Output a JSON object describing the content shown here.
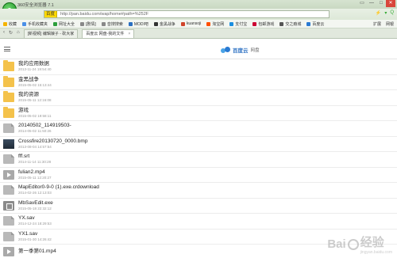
{
  "browser": {
    "title": "360安全浏览器 7.1",
    "controls": [
      "▭",
      "—",
      "□",
      "✕"
    ],
    "engine_label": "百度",
    "url": "http://pan.baidu.com/wap/home#path=%252F",
    "addr_right": [
      "⚡",
      "▾",
      "Q"
    ]
  },
  "bookmarks": {
    "items": [
      {
        "label": "收藏",
        "color": "#f5b400"
      },
      {
        "label": "手机收藏夹",
        "color": "#4a8fe7"
      },
      {
        "label": "网址大全",
        "color": "#2c9e3b"
      },
      {
        "label": "[剧情] ",
        "color": "#888"
      },
      {
        "label": "音搜搜索",
        "color": "#888"
      },
      {
        "label": "MODI吧",
        "color": "#2a6fc2"
      },
      {
        "label": "金黑战争",
        "color": "#333"
      },
      {
        "label": "kuansoji",
        "color": "#d0442b"
      },
      {
        "label": "淘宝网",
        "color": "#ff5000"
      },
      {
        "label": "支付宝",
        "color": "#1a8ee0"
      },
      {
        "label": "包邮游戏",
        "color": "#c03"
      },
      {
        "label": "交之瘾城",
        "color": "#555"
      },
      {
        "label": "百度云",
        "color": "#2a7ad3"
      }
    ],
    "ext": [
      "扩展",
      "网银"
    ]
  },
  "tabs": {
    "icons": [
      "‹",
      "↻",
      "⌂"
    ],
    "items": [
      {
        "label": "[新视频] 编辑娘子 - 砍大家",
        "active": false
      },
      {
        "label": "百度云 网盘-我的文件",
        "active": true
      }
    ]
  },
  "page": {
    "brand_name": "百度云",
    "brand_sub": "网盘",
    "files": [
      {
        "name": "我的应用数据",
        "date": "2013-11-24 19:54:40",
        "type": "folder"
      },
      {
        "name": "金黑战争",
        "date": "2015-05-02 15:13:44",
        "type": "folder"
      },
      {
        "name": "我的资源",
        "date": "2015-05-11 12:16:08",
        "type": "folder"
      },
      {
        "name": "游戏",
        "date": "2015-05-02 19:58:11",
        "type": "folder"
      },
      {
        "name": "20140502_114919503-",
        "date": "2014-05-02 11:50:26",
        "type": "file"
      },
      {
        "name": "Crossfire20130720_0000.bmp",
        "date": "2013-08-04 14:57:54",
        "type": "image"
      },
      {
        "name": "fff.srt",
        "date": "2014-11-14 11:30:28",
        "type": "file"
      },
      {
        "name": "fulian2.mp4",
        "date": "2015-05-11 12:20:27",
        "type": "video"
      },
      {
        "name": "MapEditor0-9-0 (1).exe.crdownload",
        "date": "2014-02-26 12:13:03",
        "type": "file"
      },
      {
        "name": "MbSavEdit.exe",
        "date": "2015-05-18 22:32:12",
        "type": "app"
      },
      {
        "name": "YX.sav",
        "date": "2014-12-24 18:29:53",
        "type": "file"
      },
      {
        "name": "YX1.sav",
        "date": "2015-01-30 14:26:42",
        "type": "file"
      },
      {
        "name": "第一季第01.mp4",
        "date": "",
        "type": "video"
      }
    ]
  },
  "watermark": {
    "text": "Bai",
    "text2": "经验",
    "sub": "jingyan.baidu.com"
  }
}
